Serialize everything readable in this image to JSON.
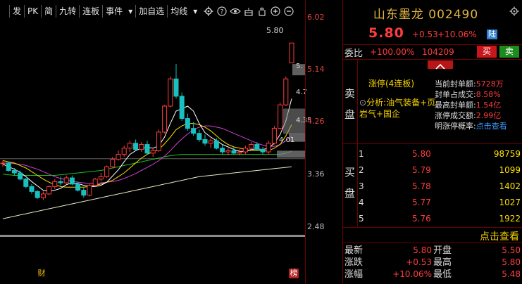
{
  "toolbar": {
    "first": "",
    "items": [
      "发",
      "PK",
      "简",
      "九转",
      "连板",
      "事件",
      "▾",
      "加自选",
      "均线",
      "▾"
    ],
    "icons": [
      "gear-icon",
      "help-icon",
      "eye-icon",
      "cake-icon",
      "hand-icon",
      "plus-icon",
      "minus-icon"
    ]
  },
  "price_axis": {
    "ticks": [
      "6.02",
      "5.14",
      "4.26",
      "3.36",
      "2.48"
    ]
  },
  "chart_labels": {
    "high": "5.80",
    "right_5": "5.",
    "right_47": "4.7",
    "right_435": "4.35",
    "low": "4.01"
  },
  "markers": {
    "cai": "财",
    "bang": "榜"
  },
  "panel": {
    "title": "山东墨龙 002490",
    "price": "5.80",
    "change": "+0.53",
    "pct": "+10.06%",
    "badge": "陆",
    "webi_label": "委比",
    "webi_pct": "+100.00%",
    "webi_vol": "104209",
    "buy": "买",
    "sell": "卖",
    "sell_side": "卖盘",
    "buy_side": "买盘",
    "board": "涨停(4连板)",
    "analysis_prefix": "分析:",
    "analysis": "油气装备+页岩气+国企",
    "seal": [
      {
        "k": "当前封单额:",
        "v": "5728万",
        "blue": false
      },
      {
        "k": "封单占成交:",
        "v": "8.58%",
        "blue": false
      },
      {
        "k": "最高封单额:",
        "v": "1.54亿",
        "blue": false
      },
      {
        "k": "涨停成交额:",
        "v": "2.99亿",
        "blue": false
      },
      {
        "k": "明涨停概率:",
        "v": "点击查看",
        "blue": true
      }
    ],
    "orderbook": [
      {
        "lvl": "1",
        "px": "5.80",
        "vol": "98759"
      },
      {
        "lvl": "2",
        "px": "5.79",
        "vol": "1099"
      },
      {
        "lvl": "3",
        "px": "5.78",
        "vol": "1402"
      },
      {
        "lvl": "4",
        "px": "5.77",
        "vol": "1027"
      },
      {
        "lvl": "5",
        "px": "5.76",
        "vol": "1922"
      }
    ],
    "dianji": "点击查看",
    "quote": [
      {
        "k1": "最新",
        "v1": "5.80",
        "k2": "开盘",
        "v2": "5.50"
      },
      {
        "k1": "涨跌",
        "v1": "+0.53",
        "k2": "最高",
        "v2": "5.80"
      },
      {
        "k1": "涨幅",
        "v1": "+10.06%",
        "k2": "最低",
        "v2": "5.48"
      }
    ]
  },
  "colors": {
    "up": "#ff3c3c",
    "down": "#18c0c0",
    "ma5": "#ffffff",
    "ma10": "#f4e000",
    "ma20": "#d040d0",
    "ma60": "#20c020",
    "ma120": "#e8e8c0"
  },
  "chart_data": {
    "type": "candlestick",
    "price_range": [
      2.2,
      6.2
    ],
    "candles": [
      [
        3.85,
        3.9,
        3.8,
        3.86
      ],
      [
        3.86,
        3.88,
        3.72,
        3.74
      ],
      [
        3.74,
        3.78,
        3.66,
        3.7
      ],
      [
        3.7,
        3.74,
        3.58,
        3.6
      ],
      [
        3.6,
        3.62,
        3.45,
        3.48
      ],
      [
        3.48,
        3.52,
        3.36,
        3.4
      ],
      [
        3.4,
        3.42,
        3.28,
        3.3
      ],
      [
        3.3,
        3.4,
        3.26,
        3.36
      ],
      [
        3.36,
        3.5,
        3.34,
        3.48
      ],
      [
        3.48,
        3.6,
        3.44,
        3.56
      ],
      [
        3.56,
        3.64,
        3.5,
        3.54
      ],
      [
        3.54,
        3.66,
        3.52,
        3.62
      ],
      [
        3.62,
        3.66,
        3.5,
        3.52
      ],
      [
        3.52,
        3.56,
        3.4,
        3.42
      ],
      [
        3.42,
        3.46,
        3.3,
        3.34
      ],
      [
        3.34,
        3.52,
        3.32,
        3.5
      ],
      [
        3.5,
        3.62,
        3.48,
        3.6
      ],
      [
        3.6,
        3.7,
        3.56,
        3.64
      ],
      [
        3.64,
        3.82,
        3.62,
        3.8
      ],
      [
        3.8,
        3.96,
        3.78,
        3.92
      ],
      [
        3.92,
        4.06,
        3.9,
        4.0
      ],
      [
        4.0,
        4.14,
        3.96,
        4.1
      ],
      [
        4.1,
        4.22,
        4.04,
        4.18
      ],
      [
        4.18,
        4.24,
        4.06,
        4.08
      ],
      [
        4.08,
        4.2,
        4.04,
        4.16
      ],
      [
        4.16,
        4.22,
        4.0,
        4.02
      ],
      [
        4.02,
        4.1,
        3.96,
        4.06
      ],
      [
        4.06,
        4.4,
        4.04,
        4.36
      ],
      [
        4.36,
        4.8,
        4.34,
        4.78
      ],
      [
        4.78,
        5.26,
        4.76,
        5.22
      ],
      [
        5.22,
        5.46,
        4.9,
        4.94
      ],
      [
        4.94,
        5.0,
        4.54,
        4.58
      ],
      [
        4.58,
        4.66,
        4.38,
        4.42
      ],
      [
        4.42,
        4.52,
        4.3,
        4.34
      ],
      [
        4.34,
        4.4,
        4.2,
        4.24
      ],
      [
        4.24,
        4.32,
        4.14,
        4.18
      ],
      [
        4.18,
        4.26,
        4.1,
        4.22
      ],
      [
        4.22,
        4.26,
        4.08,
        4.1
      ],
      [
        4.1,
        4.16,
        4.0,
        4.04
      ],
      [
        4.04,
        4.1,
        3.98,
        4.06
      ],
      [
        4.06,
        4.12,
        4.0,
        4.02
      ],
      [
        4.02,
        4.08,
        3.98,
        4.04
      ],
      [
        4.04,
        4.14,
        4.0,
        4.1
      ],
      [
        4.1,
        4.2,
        4.06,
        4.16
      ],
      [
        4.16,
        4.2,
        4.06,
        4.08
      ],
      [
        4.08,
        4.12,
        4.0,
        4.04
      ],
      [
        4.04,
        4.22,
        4.0,
        4.18
      ],
      [
        4.18,
        4.46,
        4.16,
        4.42
      ],
      [
        4.42,
        4.84,
        4.4,
        4.8
      ],
      [
        4.8,
        5.26,
        4.78,
        5.22
      ],
      [
        5.48,
        5.8,
        5.48,
        5.8
      ]
    ],
    "ma5": [
      3.84,
      3.8,
      3.76,
      3.71,
      3.64,
      3.56,
      3.49,
      3.42,
      3.4,
      3.42,
      3.45,
      3.51,
      3.54,
      3.53,
      3.5,
      3.48,
      3.48,
      3.5,
      3.55,
      3.65,
      3.75,
      3.88,
      4.0,
      4.06,
      4.1,
      4.11,
      4.1,
      4.14,
      4.28,
      4.5,
      4.7,
      4.74,
      4.78,
      4.7,
      4.5,
      4.35,
      4.28,
      4.22,
      4.16,
      4.12,
      4.08,
      4.05,
      4.05,
      4.08,
      4.09,
      4.08,
      4.1,
      4.18,
      4.32,
      4.54,
      4.9
    ],
    "ma10": [
      3.9,
      3.88,
      3.86,
      3.82,
      3.78,
      3.72,
      3.66,
      3.6,
      3.55,
      3.51,
      3.48,
      3.47,
      3.47,
      3.47,
      3.47,
      3.48,
      3.5,
      3.52,
      3.55,
      3.58,
      3.64,
      3.7,
      3.78,
      3.86,
      3.94,
      4.0,
      4.04,
      4.08,
      4.17,
      4.28,
      4.4,
      4.46,
      4.5,
      4.5,
      4.48,
      4.44,
      4.38,
      4.3,
      4.22,
      4.16,
      4.12,
      4.1,
      4.08,
      4.06,
      4.06,
      4.06,
      4.06,
      4.1,
      4.16,
      4.3,
      4.48
    ],
    "ma20": [
      3.86,
      3.86,
      3.85,
      3.84,
      3.82,
      3.79,
      3.76,
      3.72,
      3.68,
      3.64,
      3.61,
      3.59,
      3.57,
      3.55,
      3.54,
      3.53,
      3.53,
      3.54,
      3.55,
      3.56,
      3.58,
      3.61,
      3.65,
      3.69,
      3.74,
      3.79,
      3.84,
      3.9,
      3.97,
      4.06,
      4.16,
      4.25,
      4.33,
      4.4,
      4.44,
      4.46,
      4.46,
      4.44,
      4.42,
      4.38,
      4.34,
      4.3,
      4.26,
      4.22,
      4.18,
      4.15,
      4.13,
      4.13,
      4.16,
      4.22,
      4.3
    ],
    "ma60": [
      3.68,
      3.67,
      3.66,
      3.66,
      3.66,
      3.66,
      3.66,
      3.66,
      3.66,
      3.66,
      3.67,
      3.68,
      3.69,
      3.7,
      3.71,
      3.72,
      3.73,
      3.74,
      3.76,
      3.78,
      3.8,
      3.82,
      3.84,
      3.86,
      3.88,
      3.9,
      3.92,
      3.94,
      3.96,
      3.98,
      3.99,
      4.0,
      4.0,
      4.0,
      4.0,
      4.0,
      4.0,
      4.0,
      4.0,
      4.0,
      4.0,
      4.0,
      4.0,
      4.0,
      4.0,
      4.0,
      4.0,
      4.0,
      4.0,
      4.02,
      4.05
    ],
    "ma120": [
      2.96,
      2.98,
      3.0,
      3.02,
      3.04,
      3.06,
      3.08,
      3.1,
      3.12,
      3.14,
      3.16,
      3.18,
      3.2,
      3.22,
      3.24,
      3.26,
      3.28,
      3.3,
      3.32,
      3.34,
      3.36,
      3.38,
      3.4,
      3.42,
      3.44,
      3.46,
      3.48,
      3.5,
      3.52,
      3.54,
      3.56,
      3.58,
      3.6,
      3.62,
      3.64,
      3.65,
      3.66,
      3.67,
      3.68,
      3.69,
      3.7,
      3.71,
      3.72,
      3.73,
      3.74,
      3.75,
      3.76,
      3.77,
      3.78,
      3.79,
      3.8
    ],
    "ref_line": 3.93
  }
}
